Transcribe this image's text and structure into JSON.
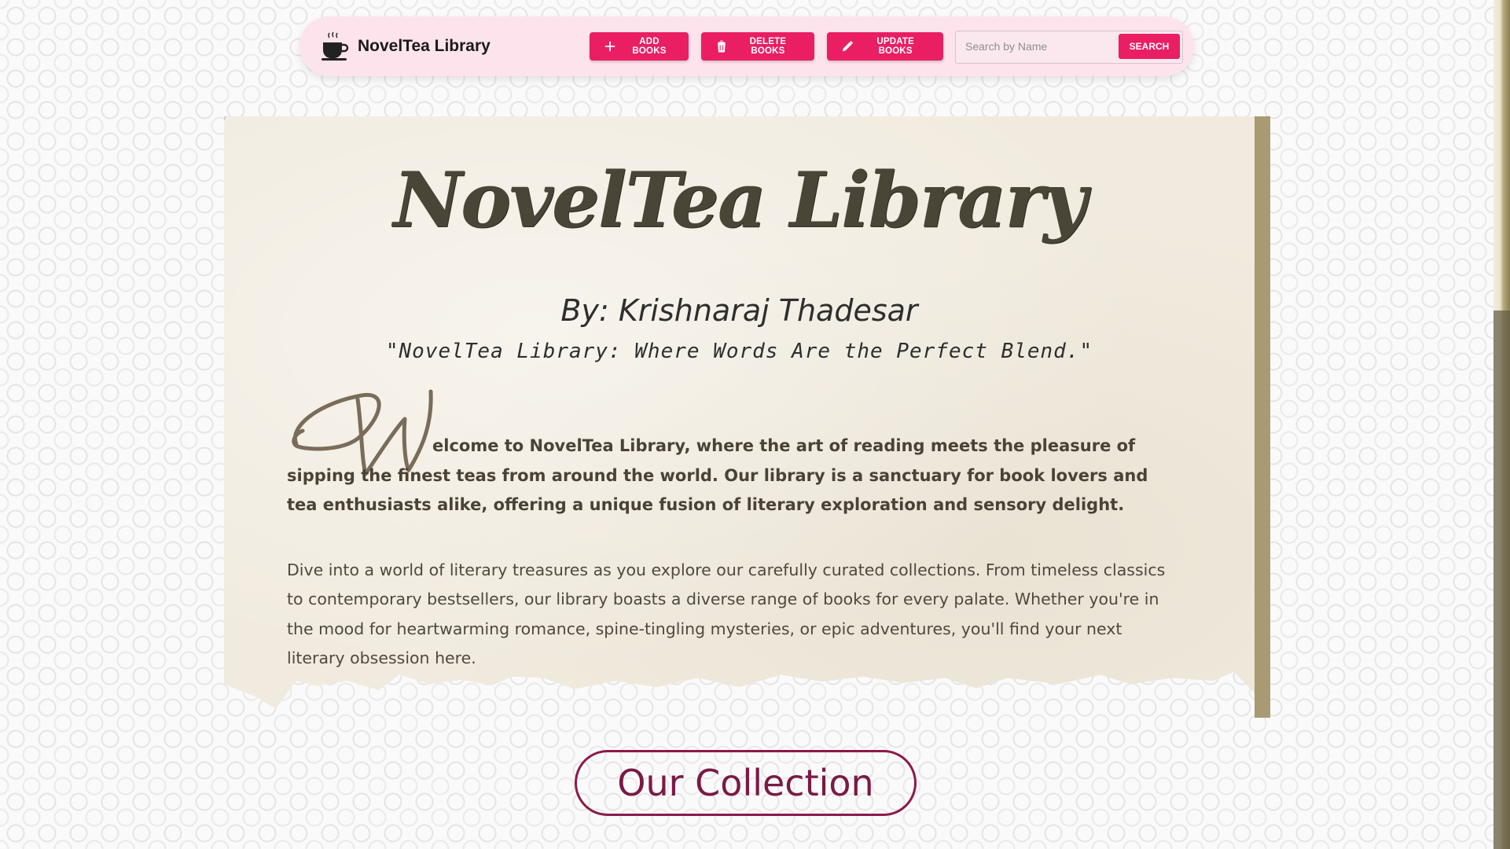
{
  "navbar": {
    "brand_name": "NovelTea Library",
    "add_label": "ADD BOOKS",
    "delete_label": "DELETE BOOKS",
    "update_label": "UPDATE BOOKS",
    "search_placeholder": "Search by Name",
    "search_label": "SEARCH",
    "accent_color": "#e91e63"
  },
  "hero": {
    "title": "NovelTea Library",
    "author": "By: Krishnaraj Thadesar",
    "tagline": "\"NovelTea Library: Where Words Are the Perfect Blend.\"",
    "para1": "elcome to NovelTea Library, where the art of reading meets the pleasure of sipping the finest teas from around the world. Our library is a sanctuary for book lovers and tea enthusiasts alike, offering a unique fusion of literary exploration and sensory delight.",
    "para2": "Dive into a world of literary treasures as you explore our carefully curated collections. From timeless classics to contemporary bestsellers, our library boasts a diverse range of books for every palate. Whether you're in the mood for heartwarming romance, spine-tingling mysteries, or epic adventures, you'll find your next literary obsession here."
  },
  "collection_label": "Our Collection"
}
